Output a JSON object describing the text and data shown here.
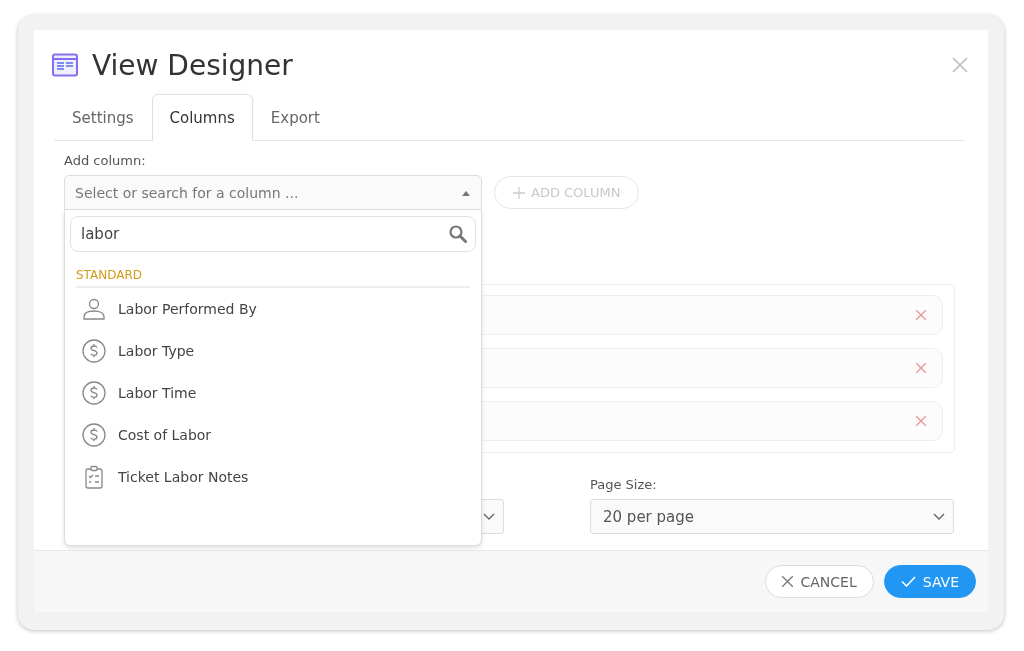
{
  "window": {
    "title": "View Designer"
  },
  "tabs": [
    {
      "label": "Settings",
      "selected": false
    },
    {
      "label": "Columns",
      "selected": true
    },
    {
      "label": "Export",
      "selected": false
    }
  ],
  "add_column": {
    "label": "Add column:",
    "placeholder": "Select or search for a column ...",
    "expanded": true,
    "button": "ADD COLUMN"
  },
  "dropdown": {
    "search_value": "labor",
    "group": "STANDARD",
    "items": [
      {
        "label": "Labor Performed By",
        "kind": "person"
      },
      {
        "label": "Labor Type",
        "kind": "money"
      },
      {
        "label": "Labor Time",
        "kind": "money"
      },
      {
        "label": "Cost of Labor",
        "kind": "money"
      },
      {
        "label": "Ticket Labor Notes",
        "kind": "notes"
      }
    ]
  },
  "selected_columns": [
    {
      "removable": true
    },
    {
      "removable": true
    },
    {
      "removable": true
    }
  ],
  "page_size": {
    "label": "Page Size:",
    "value": "20 per page"
  },
  "buttons": [
    {
      "label": "CANCEL",
      "kind": "cancel"
    },
    {
      "label": "SAVE",
      "kind": "primary"
    }
  ]
}
